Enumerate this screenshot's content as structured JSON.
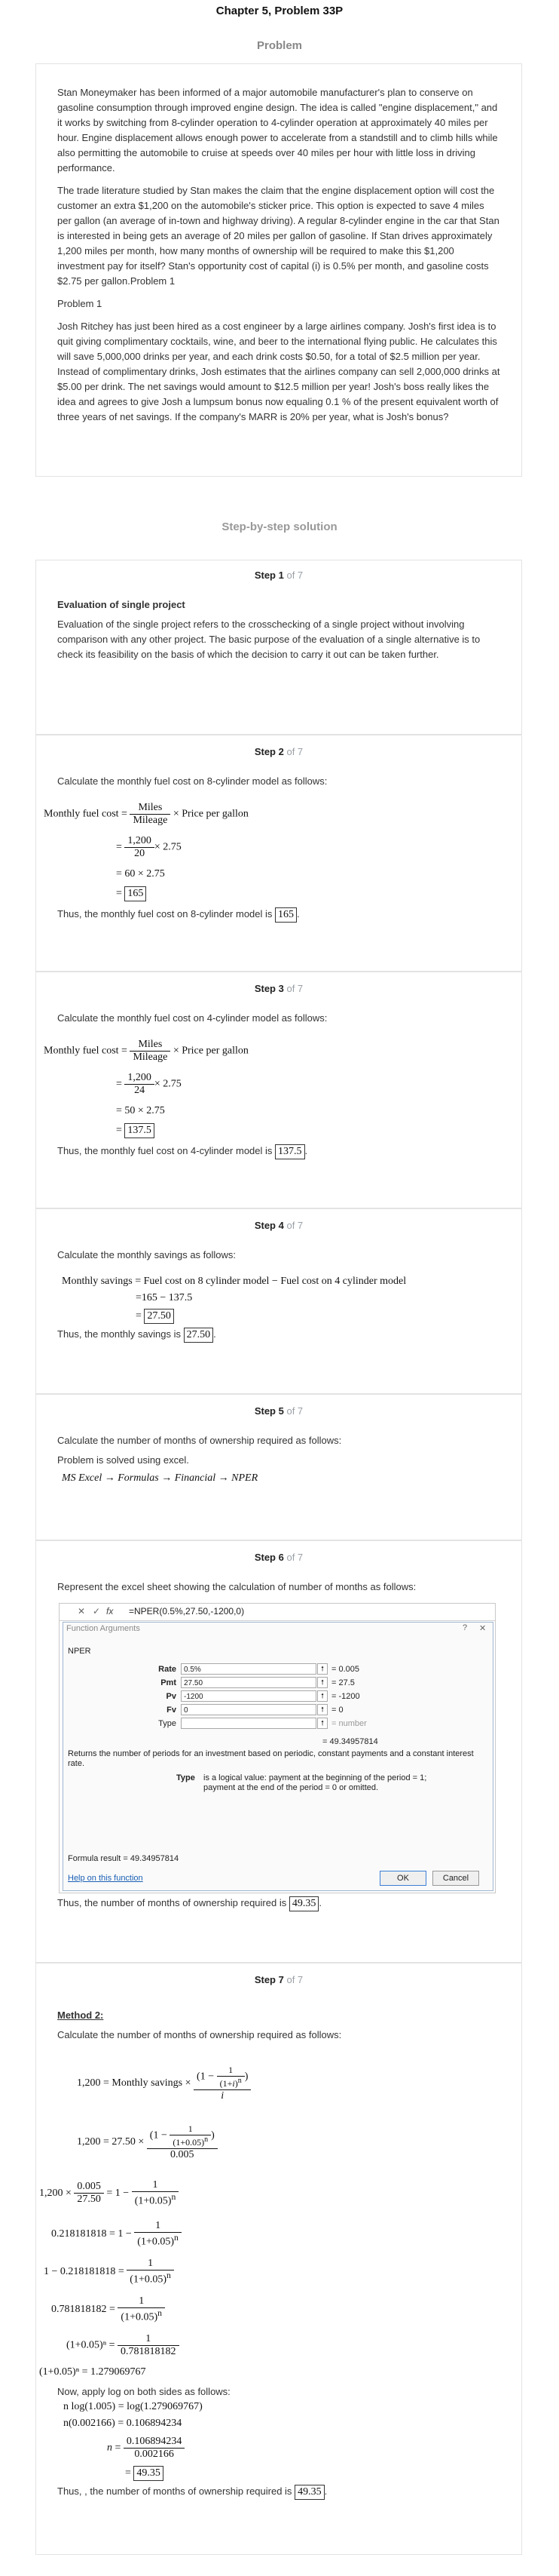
{
  "header": {
    "chapter_title": "Chapter 5, Problem 33P",
    "problem_heading": "Problem"
  },
  "problem": {
    "paragraphs": [
      "Stan Moneymaker has been informed of a major automobile manufacturer's plan to conserve on gasoline consumption through improved engine design. The idea is called \"engine displacement,\" and it works by switching from 8-cylinder operation to 4-cylinder operation at approximately 40 miles per hour. Engine displacement allows enough power to accelerate from a standstill and to climb hills while also permitting the automobile to cruise at speeds over 40 miles per hour with little loss in driving performance.",
      "The trade literature studied by Stan makes the claim that the engine displacement option will cost the customer an extra $1,200 on the automobile's sticker price. This option is expected to save 4 miles per gallon (an average of in-town and highway driving). A regular 8-cylinder engine in the car that Stan is interested in being gets an average of 20 miles per gallon of gasoline. If Stan drives approximately 1,200 miles per month, how many months of ownership will be required to make this $1,200 investment pay for itself? Stan's opportunity cost of capital (i) is 0.5% per month, and gasoline costs $2.75 per gallon.Problem 1",
      "Problem 1",
      "Josh Ritchey has just been hired as a cost engineer by a large airlines company. Josh's first idea is to quit giving complimentary cocktails, wine, and beer to the international flying public. He calculates this will save 5,000,000 drinks per year, and each drink costs $0.50, for a total of $2.5 million per year. Instead of complimentary drinks, Josh estimates that the airlines company can sell 2,000,000 drinks at $5.00 per drink. The net savings would amount to $12.5 million per year! Josh's boss really likes the idea and agrees to give Josh a lumpsum bonus now equaling 0.1 % of the present equivalent worth of three years of net savings. If the company's MARR is 20% per year, what is Josh's bonus?"
    ]
  },
  "solution_heading": "Step-by-step solution",
  "steps": [
    {
      "label": "Step 1",
      "of": "of 7",
      "heading": "Evaluation of single project",
      "text": "Evaluation of the single project refers to the crosschecking of a single project without involving comparison with any other project. The basic purpose of the evaluation of a single alternative is to check its feasibility on the basis of which the decision to carry it out can be taken further."
    },
    {
      "label": "Step 2",
      "of": "of 7",
      "intro": "Calculate the monthly fuel cost on 8-cylinder model as follows:",
      "lhs": "Monthly fuel cost",
      "frac_num": "Miles",
      "frac_den": "Mileage",
      "times_price": "× Price per gallon",
      "sub_num": "1,200",
      "sub_den": "20",
      "sub_tail": "× 2.75",
      "line3": "= 60 × 2.75",
      "result": "165",
      "conclusion": "Thus, the monthly fuel cost on 8-cylinder model is"
    },
    {
      "label": "Step 3",
      "of": "of 7",
      "intro": "Calculate the monthly fuel cost on 4-cylinder model as follows:",
      "lhs": "Monthly fuel cost",
      "frac_num": "Miles",
      "frac_den": "Mileage",
      "times_price": "× Price per gallon",
      "sub_num": "1,200",
      "sub_den": "24",
      "sub_tail": "× 2.75",
      "line3": "= 50 × 2.75",
      "result": "137.5",
      "conclusion": "Thus, the monthly fuel cost on 4-cylinder model is"
    },
    {
      "label": "Step 4",
      "of": "of 7",
      "intro": "Calculate the monthly savings as follows:",
      "eq1": "Monthly savings = Fuel cost on 8 cylinder model − Fuel cost on 4 cylinder model",
      "eq2": "=165 − 137.5",
      "result": "27.50",
      "conclusion": "Thus, the monthly savings is"
    },
    {
      "label": "Step 5",
      "of": "of 7",
      "intro": "Calculate the number of months of ownership required as follows:",
      "text2": "Problem is solved using excel.",
      "path": "MS Excel → Formulas → Financial → NPER"
    },
    {
      "label": "Step 6",
      "of": "of 7",
      "intro": "Represent the excel sheet showing the calculation of number of months as follows:",
      "conclusion": "Thus, the number of months of ownership required is",
      "result": "49.35"
    },
    {
      "label": "Step 7",
      "of": "of 7",
      "method": "Method 2:",
      "intro": "Calculate the number of months of ownership required as follows:",
      "eq_a_lhs": "1,200 = Monthly savings ×",
      "eq_b_lhs": "1,200 = 27.50 ×",
      "rate": "0.005",
      "eq_c_l1": "1,200 ×",
      "eq_c_num": "0.005",
      "eq_c_den": "27.50",
      "eq_c_mid": "= 1 −",
      "eq_d_lhs": "0.218181818 = 1 −",
      "eq_e_lhs": "1 − 0.218181818 =",
      "eq_f_lhs": "0.781818182 =",
      "eq_g_lhs": "(1+0.05)ⁿ =",
      "eq_g_den": "0.781818182",
      "eq_h": "(1+0.05)ⁿ = 1.279069767",
      "log_intro": "Now, apply log on both sides as follows:",
      "eq_i": "n log(1.005) = log(1.279069767)",
      "eq_j": "n(0.002166) = 0.106894234",
      "eq_k_num": "0.106894234",
      "eq_k_den": "0.002166",
      "result": "49.35",
      "conclusion": "Thus, , the number of months of ownership required is"
    }
  ],
  "excel": {
    "formula": "=NPER(0.5%,27.50,-1200,0)",
    "fx": "fx",
    "dialog_title": "Function Arguments",
    "function_name": "NPER",
    "args": [
      {
        "name": "Rate",
        "value": "0.5%",
        "result": "= 0.005"
      },
      {
        "name": "Pmt",
        "value": "27.50",
        "result": "= 27.5"
      },
      {
        "name": "Pv",
        "value": "-1200",
        "result": "= -1200"
      },
      {
        "name": "Fv",
        "value": "0",
        "result": "= 0"
      },
      {
        "name": "Type",
        "value": "",
        "result": "= number"
      }
    ],
    "total": "= 49.34957814",
    "description": "Returns the number of periods for an investment based on periodic, constant payments and a constant interest rate.",
    "type_label": "Type",
    "type_desc": "is a logical value: payment at the beginning of the period = 1; payment at the end of the period = 0 or omitted.",
    "formula_result": "Formula result =  49.34957814",
    "help": "Help on this function",
    "ok": "OK",
    "cancel": "Cancel"
  }
}
